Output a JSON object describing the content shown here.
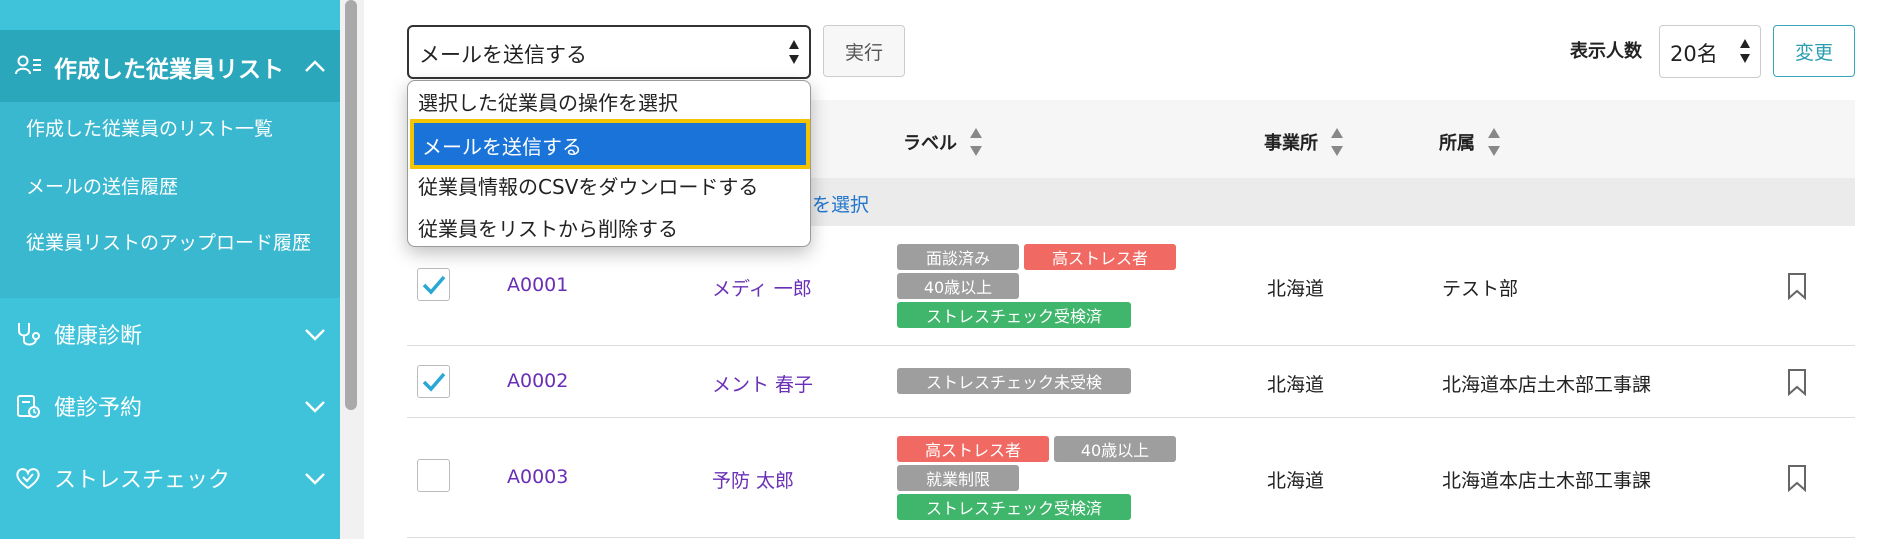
{
  "sidebar": {
    "active_section": "作成した従業員リスト",
    "sub_items": [
      "作成した従業員のリスト一覧",
      "メールの送信履歴",
      "従業員リストのアップロード履歴"
    ],
    "sections": [
      "健康診断",
      "健診予約",
      "ストレスチェック"
    ]
  },
  "toolbar": {
    "action_value": "メールを送信する",
    "run_label": "実行",
    "display_count_label": "表示人数",
    "display_count_value": "20名",
    "change_label": "変更"
  },
  "action_options": [
    "選択した従業員の操作を選択",
    "メールを送信する",
    "従業員情報のCSVをダウンロードする",
    "従業員をリストから削除する"
  ],
  "table": {
    "headers": {
      "label": "ラベル",
      "office": "事業所",
      "department": "所属"
    },
    "select_all_text": "を選択",
    "rows": [
      {
        "checked": true,
        "id": "A0001",
        "name": "メディ 一郎",
        "tags": [
          "面談済み",
          "高ストレス者",
          "40歳以上",
          "ストレスチェック受検済"
        ],
        "office": "北海道",
        "department": "テスト部"
      },
      {
        "checked": true,
        "id": "A0002",
        "name": "メント 春子",
        "tags": [
          "ストレスチェック未受検"
        ],
        "office": "北海道",
        "department": "北海道本店土木部工事課"
      },
      {
        "checked": false,
        "id": "A0003",
        "name": "予防 太郎",
        "tags": [
          "高ストレス者",
          "40歳以上",
          "就業制限",
          "ストレスチェック受検済"
        ],
        "office": "北海道",
        "department": "北海道本店土木部工事課"
      }
    ]
  },
  "colors": {
    "sidebar": "#3ec3da",
    "tag_gray": "#9e9e9e",
    "tag_red": "#f06a63",
    "tag_green": "#3fb66b",
    "link": "#6a2fb7",
    "selected_option": "#1a73d9",
    "highlight": "#f5c400"
  },
  "icons": [
    "user-list-icon",
    "stethoscope-icon",
    "clipboard-calendar-icon",
    "heart-check-icon",
    "chevron-up-icon",
    "chevron-down-icon",
    "bookmark-icon",
    "checkmark-icon"
  ]
}
